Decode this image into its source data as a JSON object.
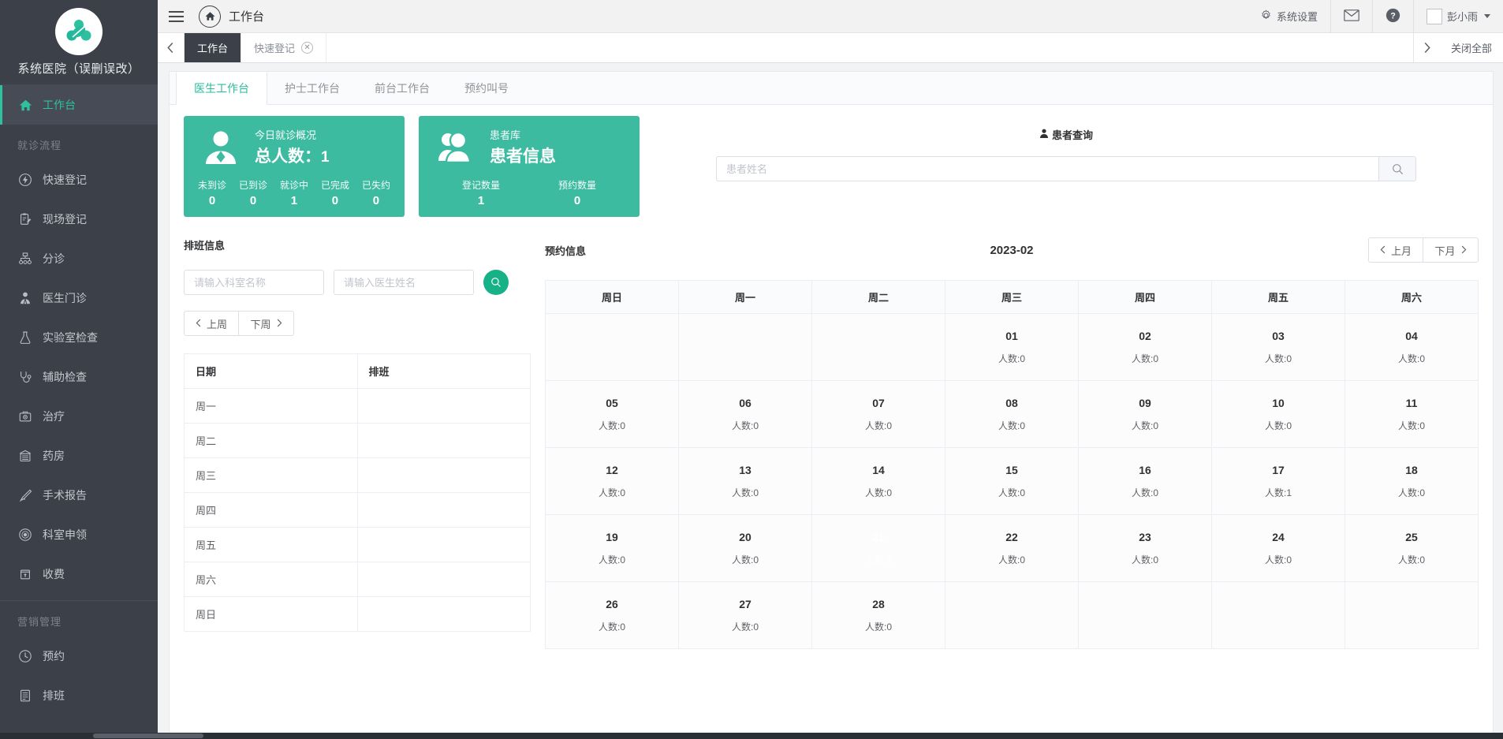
{
  "sidebar": {
    "brand_name": "系统医院（误删误改）",
    "logo_icon": "clover-people-logo",
    "top_items": [
      {
        "label": "工作台",
        "icon": "home-icon",
        "active": true
      }
    ],
    "groups": [
      {
        "title": "就诊流程",
        "items": [
          {
            "label": "快速登记",
            "icon": "lightning-circle-icon"
          },
          {
            "label": "现场登记",
            "icon": "clipboard-edit-icon"
          },
          {
            "label": "分诊",
            "icon": "sitemap-icon"
          },
          {
            "label": "医生门诊",
            "icon": "doctor-icon"
          },
          {
            "label": "实验室检查",
            "icon": "flask-icon"
          },
          {
            "label": "辅助检查",
            "icon": "stethoscope-icon"
          },
          {
            "label": "治疗",
            "icon": "medical-kit-icon"
          },
          {
            "label": "药房",
            "icon": "pharmacy-icon"
          },
          {
            "label": "手术报告",
            "icon": "scalpel-icon"
          },
          {
            "label": "科室申领",
            "icon": "target-circle-icon"
          },
          {
            "label": "收费",
            "icon": "cashbox-icon"
          }
        ]
      },
      {
        "title": "营销管理",
        "items": [
          {
            "label": "预约",
            "icon": "clock-icon"
          },
          {
            "label": "排班",
            "icon": "list-board-icon"
          }
        ]
      }
    ]
  },
  "topbar": {
    "menu_icon": "hamburger-icon",
    "home_icon": "home-icon",
    "page_title": "工作台",
    "settings_icon": "gear-icon",
    "settings_label": "系统设置",
    "mail_icon": "envelope-icon",
    "help_icon": "question-circle-icon",
    "avatar_icon": "avatar-placeholder",
    "user_name": "彭小雨",
    "user_caret_icon": "caret-down-icon"
  },
  "tabstrip": {
    "prev_icon": "chevron-left-icon",
    "next_icon": "chevron-right-icon",
    "close_all_label": "关闭全部",
    "tabs": [
      {
        "label": "工作台",
        "active": true,
        "closable": false
      },
      {
        "label": "快速登记",
        "active": false,
        "closable": true,
        "close_icon": "close-circle-icon"
      }
    ]
  },
  "subtabs": [
    {
      "label": "医生工作台",
      "active": true
    },
    {
      "label": "护士工作台",
      "active": false
    },
    {
      "label": "前台工作台",
      "active": false
    },
    {
      "label": "预约叫号",
      "active": false
    }
  ],
  "cards": {
    "today": {
      "icon": "person-silhouette-icon",
      "caption": "今日就诊概况",
      "headline_label": "总人数：",
      "headline_value": "1",
      "metrics": [
        {
          "label": "未到诊",
          "value": "0"
        },
        {
          "label": "已到诊",
          "value": "0"
        },
        {
          "label": "就诊中",
          "value": "1"
        },
        {
          "label": "已完成",
          "value": "0"
        },
        {
          "label": "已失约",
          "value": "0"
        }
      ]
    },
    "patients": {
      "icon": "two-people-icon",
      "caption": "患者库",
      "headline_label": "患者信息",
      "metrics": [
        {
          "label": "登记数量",
          "value": "1"
        },
        {
          "label": "预约数量",
          "value": "0"
        }
      ]
    }
  },
  "patient_search": {
    "icon": "person-badge-icon",
    "title": "患者查询",
    "placeholder": "患者姓名",
    "value": "",
    "button_icon": "search-icon"
  },
  "schedule": {
    "title": "排班信息",
    "dept_placeholder": "请输入科室名称",
    "dept_value": "",
    "doctor_placeholder": "请输入医生姓名",
    "doctor_value": "",
    "search_icon": "search-icon",
    "prev_week_label": "上周",
    "next_week_label": "下周",
    "prev_icon": "chevron-left-icon",
    "next_icon": "chevron-right-icon",
    "columns": [
      "日期",
      "排班"
    ],
    "rows": [
      {
        "date": "周一",
        "shift": ""
      },
      {
        "date": "周二",
        "shift": ""
      },
      {
        "date": "周三",
        "shift": ""
      },
      {
        "date": "周四",
        "shift": ""
      },
      {
        "date": "周五",
        "shift": ""
      },
      {
        "date": "周六",
        "shift": ""
      },
      {
        "date": "周日",
        "shift": ""
      }
    ]
  },
  "appointments": {
    "title": "预约信息",
    "month": "2023-02",
    "prev_month_label": "上月",
    "next_month_label": "下月",
    "prev_icon": "chevron-left-icon",
    "next_icon": "chevron-right-icon",
    "weekday_headers": [
      "周日",
      "周一",
      "周二",
      "周三",
      "周四",
      "周五",
      "周六"
    ],
    "count_prefix": "人数:",
    "selected_day": "21",
    "weeks": [
      [
        {
          "day": "",
          "count": ""
        },
        {
          "day": "",
          "count": ""
        },
        {
          "day": "",
          "count": ""
        },
        {
          "day": "01",
          "count": "0"
        },
        {
          "day": "02",
          "count": "0"
        },
        {
          "day": "03",
          "count": "0"
        },
        {
          "day": "04",
          "count": "0"
        }
      ],
      [
        {
          "day": "05",
          "count": "0"
        },
        {
          "day": "06",
          "count": "0"
        },
        {
          "day": "07",
          "count": "0"
        },
        {
          "day": "08",
          "count": "0"
        },
        {
          "day": "09",
          "count": "0"
        },
        {
          "day": "10",
          "count": "0"
        },
        {
          "day": "11",
          "count": "0"
        }
      ],
      [
        {
          "day": "12",
          "count": "0"
        },
        {
          "day": "13",
          "count": "0"
        },
        {
          "day": "14",
          "count": "0"
        },
        {
          "day": "15",
          "count": "0"
        },
        {
          "day": "16",
          "count": "0"
        },
        {
          "day": "17",
          "count": "1"
        },
        {
          "day": "18",
          "count": "0"
        }
      ],
      [
        {
          "day": "19",
          "count": "0"
        },
        {
          "day": "20",
          "count": "0"
        },
        {
          "day": "21",
          "count": "1",
          "selected": true
        },
        {
          "day": "22",
          "count": "0"
        },
        {
          "day": "23",
          "count": "0"
        },
        {
          "day": "24",
          "count": "0"
        },
        {
          "day": "25",
          "count": "0"
        }
      ],
      [
        {
          "day": "26",
          "count": "0"
        },
        {
          "day": "27",
          "count": "0"
        },
        {
          "day": "28",
          "count": "0"
        },
        {
          "day": "",
          "count": ""
        },
        {
          "day": "",
          "count": ""
        },
        {
          "day": "",
          "count": ""
        },
        {
          "day": "",
          "count": ""
        }
      ]
    ]
  },
  "colors": {
    "brand_teal": "#3dbba1",
    "accent_teal": "#16b187",
    "sidebar_bg": "#3c4049",
    "selected_day_red": "#f0706f"
  }
}
